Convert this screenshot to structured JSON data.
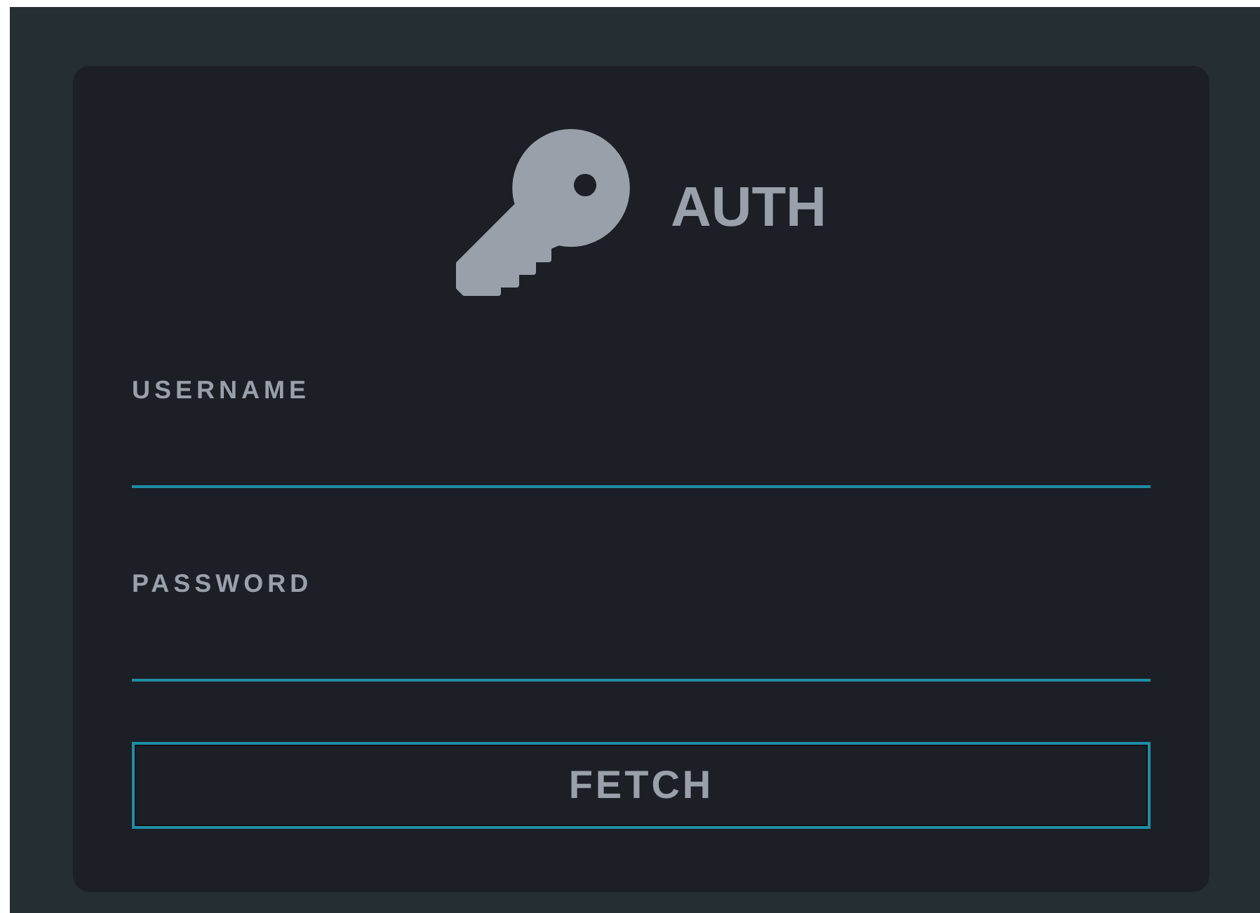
{
  "login": {
    "title": "AUTH",
    "fields": [
      {
        "label": "USERNAME"
      },
      {
        "label": "PASSWORD"
      }
    ],
    "button": "FETCH"
  }
}
